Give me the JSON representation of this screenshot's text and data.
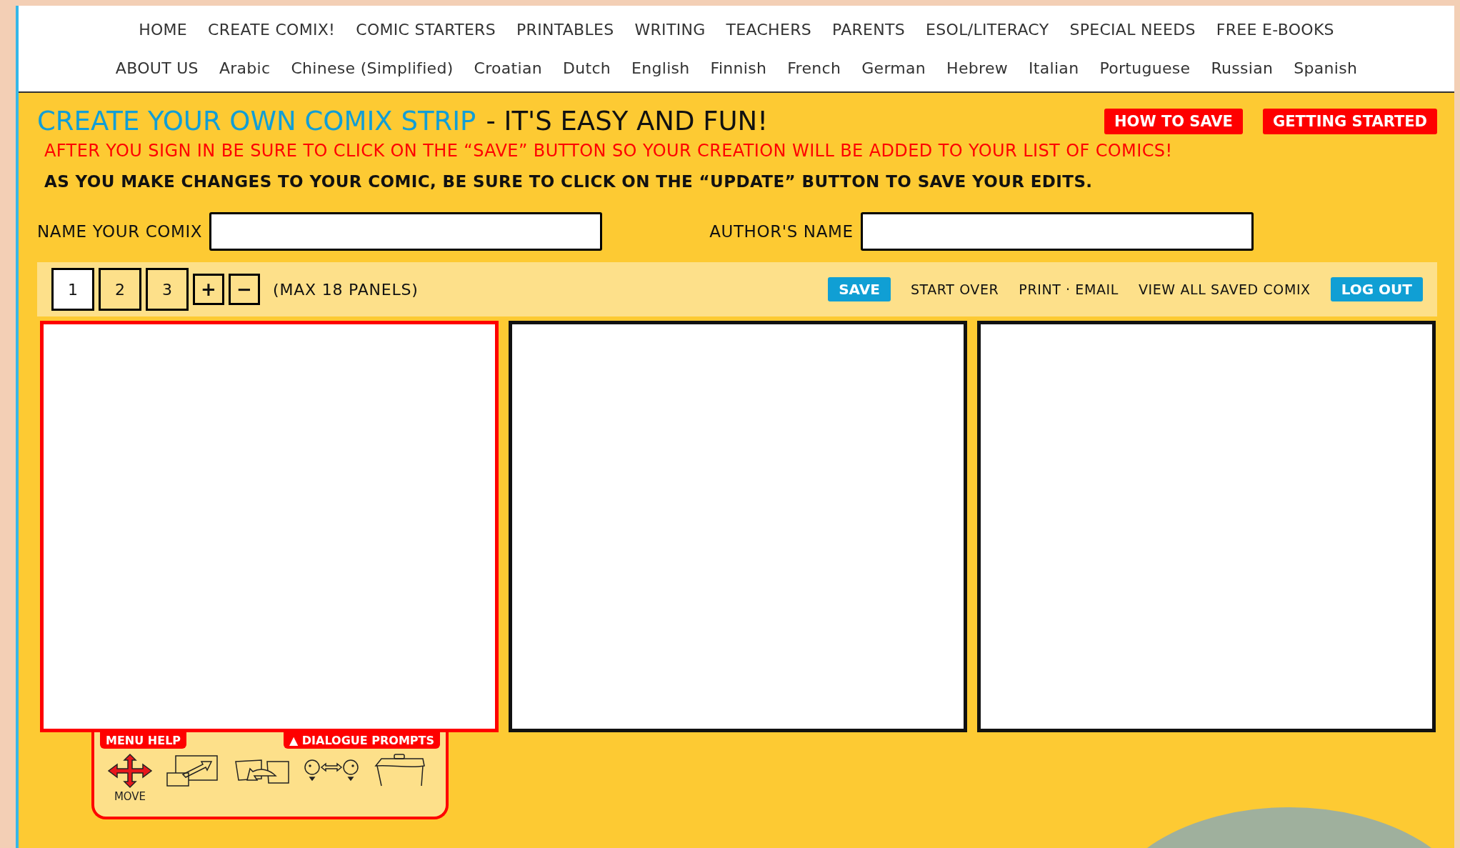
{
  "nav": {
    "primary": [
      "HOME",
      "CREATE COMIX!",
      "COMIC STARTERS",
      "PRINTABLES",
      "WRITING",
      "TEACHERS",
      "PARENTS",
      "ESOL/LITERACY",
      "SPECIAL NEEDS",
      "FREE E-BOOKS"
    ],
    "languages": [
      "ABOUT US",
      "Arabic",
      "Chinese (Simplified)",
      "Croatian",
      "Dutch",
      "English",
      "Finnish",
      "French",
      "German",
      "Hebrew",
      "Italian",
      "Portuguese",
      "Russian",
      "Spanish"
    ]
  },
  "header": {
    "title": "CREATE YOUR OWN COMIX STRIP",
    "tagline": "- IT'S EASY AND FUN!",
    "buttons": [
      "HOW TO SAVE",
      "GETTING STARTED"
    ],
    "notice": "AFTER YOU SIGN IN BE SURE TO CLICK ON THE “SAVE” BUTTON SO YOUR CREATION WILL BE ADDED TO YOUR LIST OF COMICS!",
    "hint": "AS YOU MAKE CHANGES TO YOUR COMIC, BE SURE TO CLICK ON THE “UPDATE” BUTTON TO SAVE YOUR EDITS."
  },
  "fields": [
    {
      "label": "NAME YOUR COMIX"
    },
    {
      "label": "AUTHOR'S NAME"
    }
  ],
  "toolbar": {
    "panel_tabs": [
      {
        "label": "1",
        "selected": true
      },
      {
        "label": "2",
        "selected": false
      },
      {
        "label": "3",
        "selected": false
      }
    ],
    "add": "+",
    "remove": "−",
    "max_note": "(MAX 18 PANELS)",
    "actions": [
      {
        "label": "SAVE",
        "kind": "button"
      },
      {
        "label": "START OVER",
        "kind": "link"
      },
      {
        "label": "PRINT · EMAIL",
        "kind": "link"
      },
      {
        "label": "VIEW ALL SAVED COMIX",
        "kind": "link"
      },
      {
        "label": "LOG OUT",
        "kind": "button"
      }
    ]
  },
  "panels": [
    {
      "selected": true
    },
    {
      "selected": false
    },
    {
      "selected": false
    }
  ],
  "tool_menu": {
    "tabs": [
      "MENU HELP",
      "▲ DIALOGUE PROMPTS"
    ],
    "tools": [
      {
        "kind": "move",
        "label": "MOVE"
      },
      {
        "kind": "resize"
      },
      {
        "kind": "swap"
      },
      {
        "kind": "dialogue"
      },
      {
        "kind": "box"
      }
    ]
  }
}
